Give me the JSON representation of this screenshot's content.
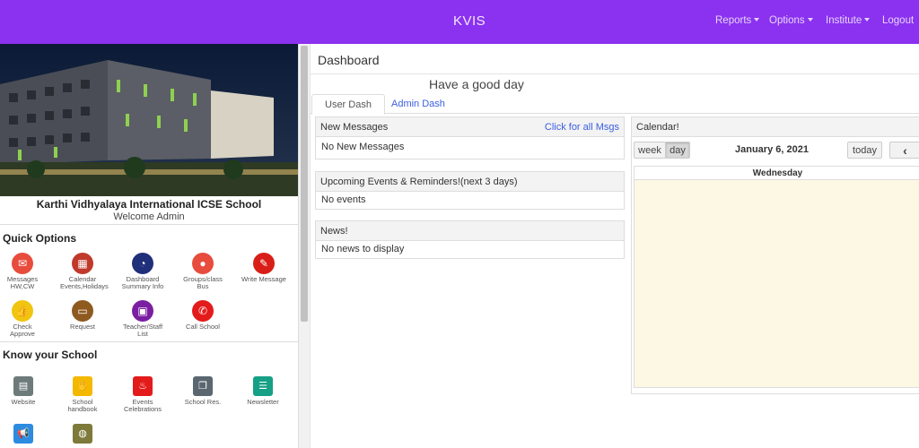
{
  "navbar": {
    "brand": "KVIS",
    "items": [
      {
        "label": "Reports",
        "dropdown": true
      },
      {
        "label": "Options",
        "dropdown": true
      },
      {
        "label": "Institute",
        "dropdown": true
      },
      {
        "label": "Logout",
        "dropdown": false
      }
    ],
    "color": "#8b31f0"
  },
  "left": {
    "school_name": "Karthi Vidhyalaya International ICSE School",
    "welcome": "Welcome Admin",
    "quick_options": {
      "title": "Quick Options",
      "items": [
        {
          "icon": "envelope-icon",
          "label": "Messages HW,CW",
          "color": "#e84c3d"
        },
        {
          "icon": "calendar-icon",
          "label": "Calendar Events,Holidays",
          "color": "#c0392b"
        },
        {
          "icon": "pie-chart-icon",
          "label": "Dashboard Summary Info",
          "color": "#1f2f7a"
        },
        {
          "icon": "group-icon",
          "label": "Groups/class Bus",
          "color": "#e74c3c"
        },
        {
          "icon": "pencil-icon",
          "label": "Write Message",
          "color": "#d91e18"
        },
        {
          "icon": "thumbs-up-icon",
          "label": "Check Approve",
          "color": "#f1c40f"
        },
        {
          "icon": "card-icon",
          "label": "Request",
          "color": "#8e5a1e"
        },
        {
          "icon": "presentation-icon",
          "label": "Teacher/Staff List",
          "color": "#7b1fa2"
        },
        {
          "icon": "phone-icon",
          "label": "Call School",
          "color": "#e31b1b"
        }
      ]
    },
    "know_school": {
      "title": "Know your School",
      "items": [
        {
          "icon": "book-icon",
          "label": "Website",
          "color": "#6d7b7a"
        },
        {
          "icon": "handshake-icon",
          "label": "School handbook",
          "color": "#f5b800"
        },
        {
          "icon": "cake-icon",
          "label": "Events Celebrations",
          "color": "#e31b1b"
        },
        {
          "icon": "copy-icon",
          "label": "School Res.",
          "color": "#5b6770"
        },
        {
          "icon": "newspaper-icon",
          "label": "Newsletter",
          "color": "#16a085"
        },
        {
          "icon": "megaphone-icon",
          "label": "",
          "color": "#2d8be0"
        },
        {
          "icon": "globe-icon",
          "label": "",
          "color": "#7d7a3a"
        }
      ]
    }
  },
  "main": {
    "title": "Dashboard",
    "greeting": "Have a good day",
    "tabs": [
      {
        "label": "User Dash",
        "active": true
      },
      {
        "label": "Admin Dash",
        "active": false
      }
    ],
    "messages": {
      "title": "New Messages",
      "link": "Click for all Msgs",
      "body": "No New Messages"
    },
    "events": {
      "title": "Upcoming Events & Reminders!(next 3 days)",
      "body": "No events"
    },
    "news": {
      "title": "News!",
      "body": "No news to display"
    },
    "calendar": {
      "title": "Calendar!",
      "view_buttons": [
        "week",
        "day"
      ],
      "active_view": "day",
      "date": "January 6, 2021",
      "today_label": "today",
      "prev_label": "‹",
      "weekday": "Wednesday"
    }
  }
}
